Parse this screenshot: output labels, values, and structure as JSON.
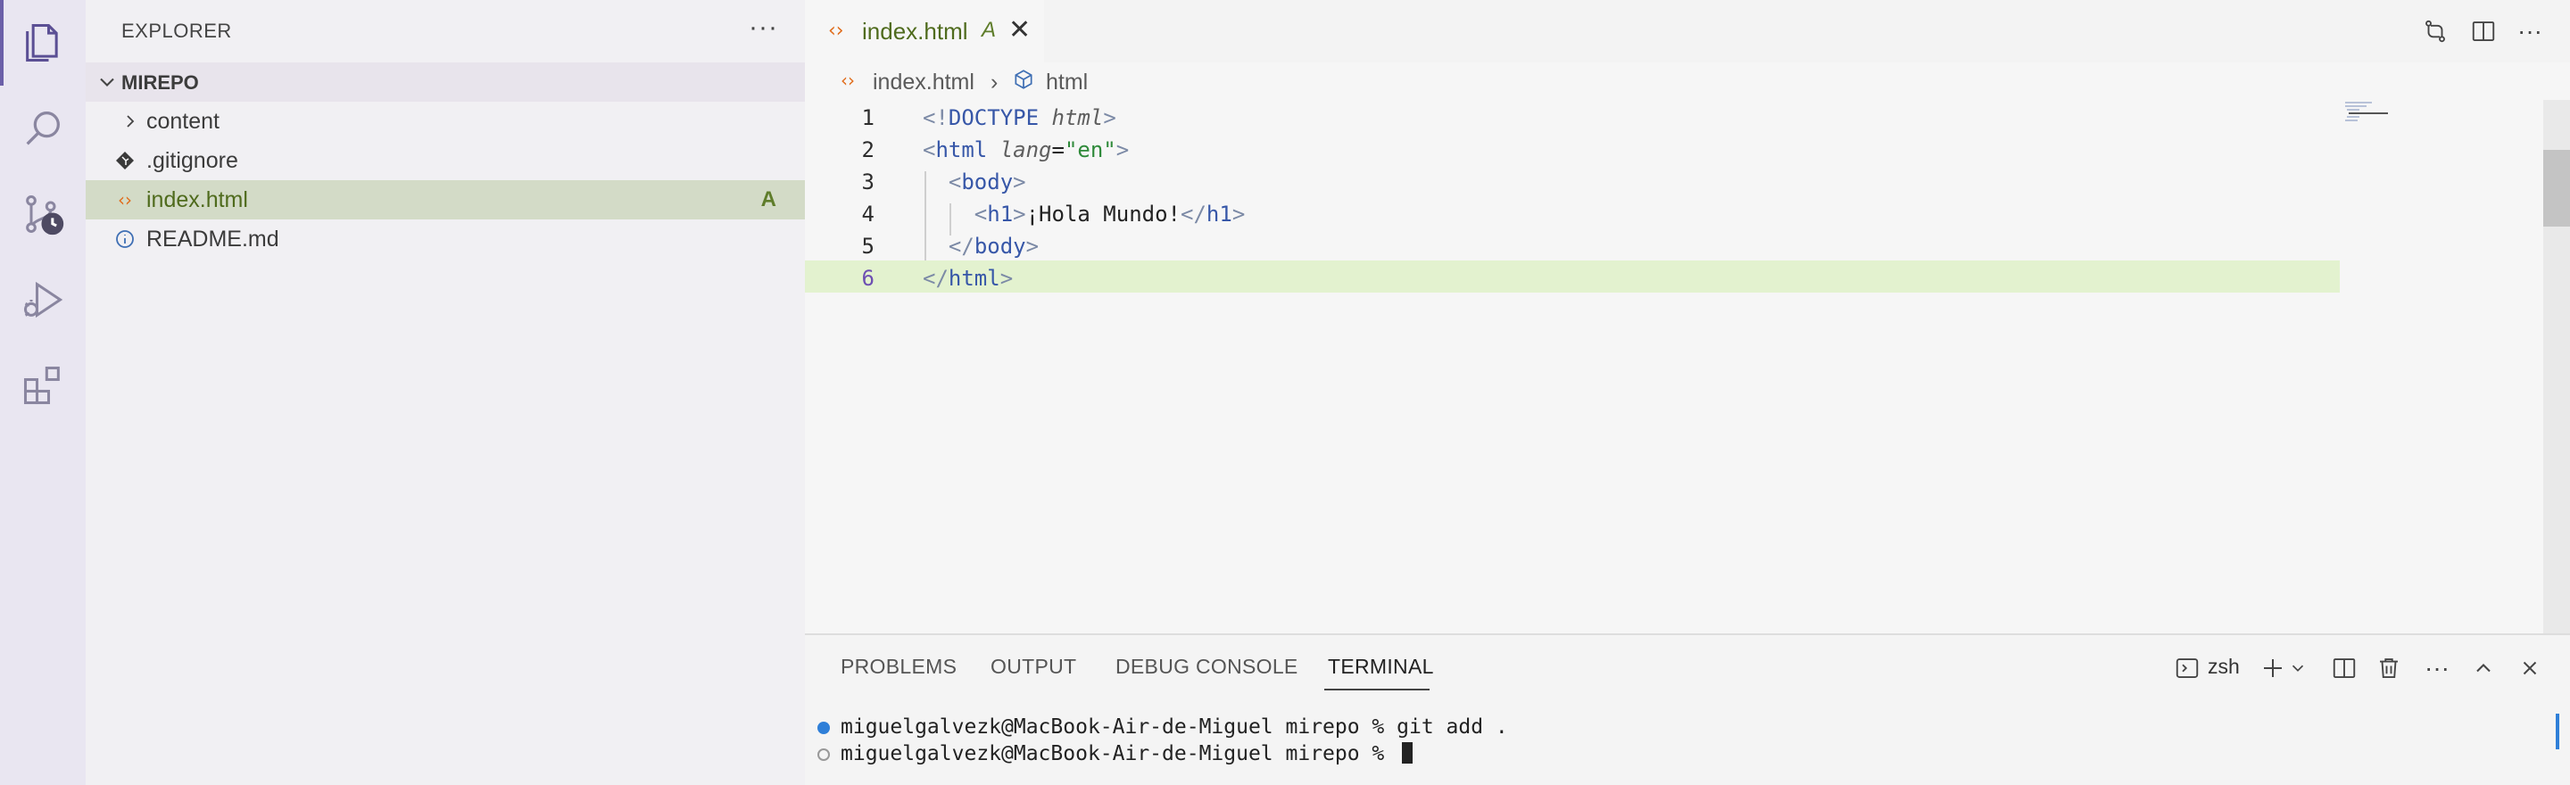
{
  "activity_bar": {
    "items": [
      {
        "name": "explorer-icon",
        "active": true
      },
      {
        "name": "search-icon",
        "active": false
      },
      {
        "name": "source-control-icon",
        "active": false
      },
      {
        "name": "run-debug-icon",
        "active": false
      },
      {
        "name": "extensions-icon",
        "active": false
      }
    ]
  },
  "sidebar": {
    "title": "EXPLORER",
    "more": "···",
    "section": "MIREPO",
    "items": [
      {
        "label": "content",
        "icon": "chevron-right-icon"
      },
      {
        "label": ".gitignore",
        "icon": "git-diamond-icon"
      },
      {
        "label": "index.html",
        "icon": "code-brackets-icon",
        "badge": "A",
        "selected": true
      },
      {
        "label": "README.md",
        "icon": "info-icon"
      }
    ]
  },
  "editor": {
    "tab": {
      "label": "index.html",
      "badge": "A",
      "close": "✕",
      "icon": "‹›"
    },
    "breadcrumb": {
      "file": "index.html",
      "symbol": "html"
    },
    "lines": [
      {
        "num": "1"
      },
      {
        "num": "2"
      },
      {
        "num": "3"
      },
      {
        "num": "4"
      },
      {
        "num": "5"
      },
      {
        "num": "6"
      }
    ],
    "code": {
      "l1_open": "<!",
      "l1_kw": "DOCTYPE",
      "l1_attr": "html",
      "l1_close": ">",
      "l2_open": "<",
      "l2_tag": "html",
      "l2_attr": "lang",
      "l2_eq": "=",
      "l2_str": "\"en\"",
      "l2_close": ">",
      "l3_open": "<",
      "l3_tag": "body",
      "l3_close": ">",
      "l4_open": "<",
      "l4_tag": "h1",
      "l4_close": ">",
      "l4_text": "¡Hola Mundo!",
      "l4_end_open": "</",
      "l4_end_tag": "h1",
      "l4_end_close": ">",
      "l5_open": "</",
      "l5_tag": "body",
      "l5_close": ">",
      "l6_open": "</",
      "l6_tag": "html",
      "l6_close": ">"
    }
  },
  "panel": {
    "tabs": [
      "PROBLEMS",
      "OUTPUT",
      "DEBUG CONSOLE",
      "TERMINAL"
    ],
    "active_tab": "TERMINAL",
    "shell": "zsh",
    "terminal_lines": [
      "miguelgalvezk@MacBook-Air-de-Miguel mirepo % git add .",
      "miguelgalvezk@MacBook-Air-de-Miguel mirepo % "
    ]
  },
  "colors": {
    "accent": "#6b5fa8",
    "added": "#5f7d2b",
    "selection": "#d3dbc7",
    "current_line": "#e3f2cf"
  }
}
